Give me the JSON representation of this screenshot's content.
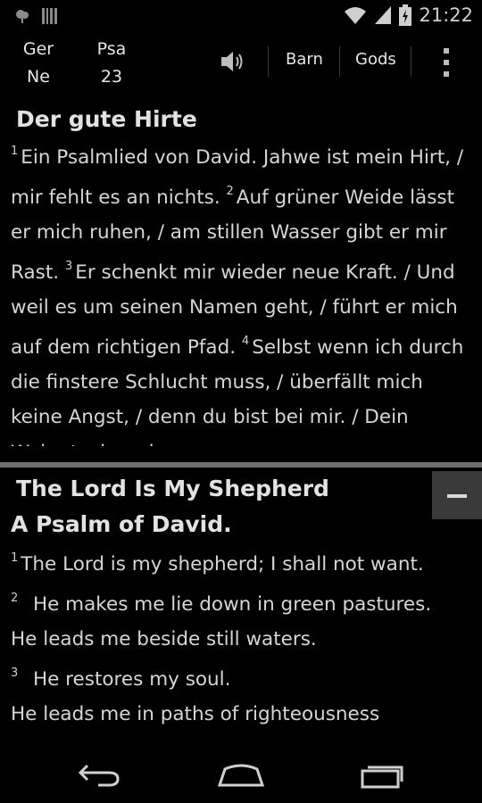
{
  "status_bar": {
    "time": "21:22",
    "icons": [
      "tree-notification-icon",
      "barcode-notification-icon",
      "wifi-icon",
      "cell-signal-icon",
      "battery-charging-icon"
    ]
  },
  "action_bar": {
    "translation_abbrev_line1": "Ger",
    "translation_abbrev_line2": "Ne",
    "book_abbrev": "Psa",
    "chapter": "23",
    "button_1": "Barn",
    "button_2": "Gods"
  },
  "top_pane": {
    "heading": "Der gute Hirte",
    "verses": [
      {
        "n": "1",
        "text": "Ein Psalmlied von David. Jahwe ist mein Hirt, / mir fehlt es an nichts."
      },
      {
        "n": "2",
        "text": "Auf grüner Weide lässt er mich ruhen, / am stillen Wasser gibt er mir Rast."
      },
      {
        "n": "3",
        "text": "Er schenkt mir wieder neue Kraft. / Und weil es um seinen Namen geht, / führt er mich auf dem richtigen Pfad."
      },
      {
        "n": "4",
        "text": "Selbst wenn ich durch die finstere Schlucht muss, / überfällt mich keine Angst, / denn du bist bei mir. / Dein Wehrstock und"
      }
    ]
  },
  "bottom_pane": {
    "heading": "The Lord Is My Shepherd",
    "subheading": "A Psalm of David.",
    "verses": [
      {
        "n": "1",
        "line1": "The Lord is my shepherd; I shall not want."
      },
      {
        "n": "2",
        "line1": "He makes me lie down in green pastures.",
        "line2": "He leads me beside still waters."
      },
      {
        "n": "3",
        "line1": "He restores my soul.",
        "line2": "He leads me in paths of righteousness"
      }
    ]
  },
  "colors": {
    "background": "#000000",
    "text": "#d6d6d6",
    "splitter": "#6e6e6e",
    "collapse_button": "#3a3a3a"
  }
}
